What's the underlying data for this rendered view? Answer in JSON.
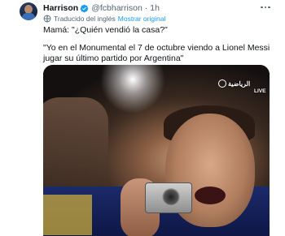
{
  "tweet": {
    "display_name": "Harrison",
    "handle": "@fcbharrison",
    "separator": "·",
    "time": "1h",
    "translated_label": "Traducido del inglés",
    "show_original": "Mostrar original",
    "text_line1": "Mamá: \"¿Quién vendió la casa?\"",
    "text_line2": "\"Yo en el Monumental el 7 de octubre viendo a Lionel Messi jugar su último partido por Argentina\""
  },
  "media": {
    "channel_logo_text": "الرياضية",
    "live_text": "LIVE"
  },
  "colors": {
    "accent": "#1d9bf0",
    "secondary_text": "#536471",
    "primary_text": "#0f1419"
  },
  "icons": {
    "verified": "verified-badge-icon",
    "more": "more-options-icon",
    "translate": "translate-icon"
  }
}
